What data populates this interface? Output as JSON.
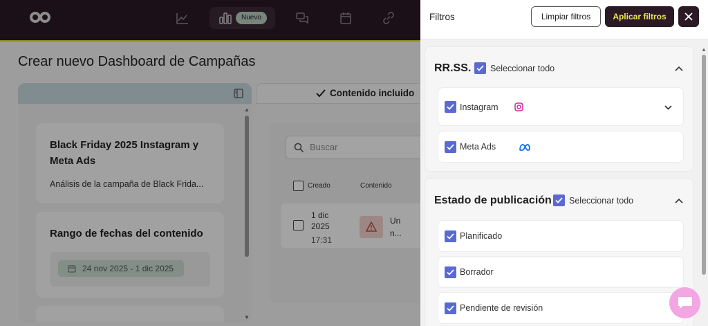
{
  "header": {
    "nav_badge": "Nuevo"
  },
  "page": {
    "title": "Crear nuevo Dashboard de Campañas",
    "included_tab_label": "Contenido incluido",
    "campaign_card": {
      "title_line1": "Black Friday 2025 Instagram y",
      "title_line2": "Meta Ads",
      "description": "Análisis de la campaña de Black Frida..."
    },
    "date_card": {
      "title": "Rango de fechas del contenido",
      "date_range": "24 nov 2025 - 1 dic 2025"
    },
    "search": {
      "placeholder": "Buscar"
    },
    "table": {
      "columns": [
        "Creado",
        "Contenido"
      ],
      "row": {
        "date_line1": "1 dic",
        "date_line2": "2025",
        "time": "17:31",
        "content_line1": "Un",
        "content_line2": "n..."
      }
    }
  },
  "drawer": {
    "title": "Filtros",
    "clear_label": "Limpiar filtros",
    "apply_label": "Aplicar filtros",
    "sections": [
      {
        "title": "RR.SS.",
        "select_all_label": "Seleccionar todo",
        "options": [
          {
            "label": "Instagram"
          },
          {
            "label": "Meta Ads"
          }
        ]
      },
      {
        "title": "Estado de publicación",
        "select_all_label": "Seleccionar todo",
        "options": [
          {
            "label": "Planificado"
          },
          {
            "label": "Borrador"
          },
          {
            "label": "Pendiente de revisión"
          }
        ]
      }
    ]
  },
  "colors": {
    "header_bg": "#2b1a26",
    "accent_yellow": "#e9e64a",
    "checkbox_blue": "#5b6ad0",
    "chat_pink": "#f2a7e2"
  }
}
